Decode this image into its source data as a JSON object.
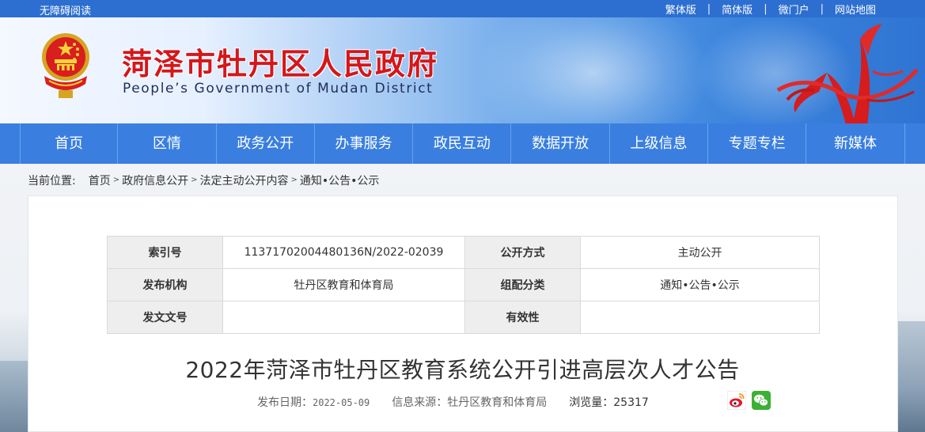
{
  "topbar": {
    "accessibility": "无障碍阅读",
    "links": [
      "繁体版",
      "简体版",
      "微门户",
      "网站地图"
    ],
    "separator": "|"
  },
  "header": {
    "title": "菏泽市牡丹区人民政府",
    "subtitle": "People’s Government of Mudan District"
  },
  "nav": {
    "items": [
      "首页",
      "区情",
      "政务公开",
      "办事服务",
      "政民互动",
      "数据开放",
      "上级信息",
      "专题专栏",
      "新媒体"
    ]
  },
  "breadcrumb": {
    "label": "当前位置:",
    "items": [
      "首页",
      "政府信息公开",
      "法定主动公开内容",
      "通知•公告•公示"
    ],
    "arrow": ">"
  },
  "info_table": {
    "rows": [
      {
        "k1": "索引号",
        "v1": "11371702004480136N/2022-02039",
        "k2": "公开方式",
        "v2": "主动公开"
      },
      {
        "k1": "发布机构",
        "v1": "牡丹区教育和体育局",
        "k2": "组配分类",
        "v2": "通知•公告•公示"
      },
      {
        "k1": "发文文号",
        "v1": "",
        "k2": "有效性",
        "v2": ""
      }
    ]
  },
  "article": {
    "title": "2022年菏泽市牡丹区教育系统公开引进高层次人才公告",
    "date_label": "发布日期：",
    "date": "2022-05-09",
    "source_label": "信息来源：",
    "source": "牡丹区教育和体育局",
    "views_label": "浏览量：",
    "views": "25317"
  },
  "colors": {
    "nav_bg": "#3a7fe0",
    "title_red": "#d4171b",
    "topbar_bg": "#2d6fd0"
  },
  "icons": [
    "emblem-icon",
    "weibo-share-icon",
    "wechat-share-icon"
  ]
}
